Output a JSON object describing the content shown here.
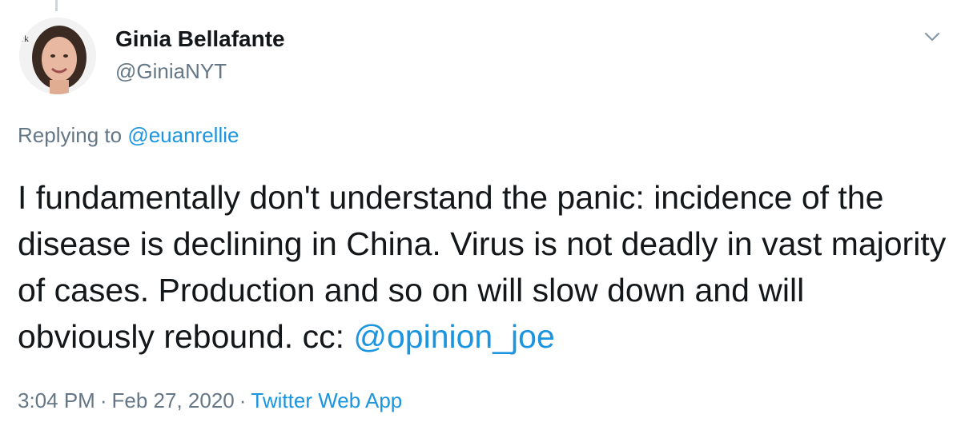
{
  "author": {
    "name": "Ginia Bellafante",
    "handle": "@GiniaNYT"
  },
  "reply": {
    "prefix": "Replying to",
    "mention": "@euanrellie"
  },
  "tweet": {
    "text": "I fundamentally don't understand the panic: incidence of the disease is declining in China. Virus is not deadly in vast majority of cases. Production and so on will slow down and will obviously rebound. cc:",
    "mention": "@opinion_joe"
  },
  "meta": {
    "time": "3:04 PM",
    "date": "Feb 27, 2020",
    "separator": "·",
    "source": "Twitter Web App"
  },
  "icons": {
    "menu": "chevron-down-icon",
    "avatar": "profile-photo"
  },
  "colors": {
    "link": "#1b95e0",
    "secondary_text": "#657786",
    "primary_text": "#14171a",
    "thread_line": "#ccd6dd"
  }
}
